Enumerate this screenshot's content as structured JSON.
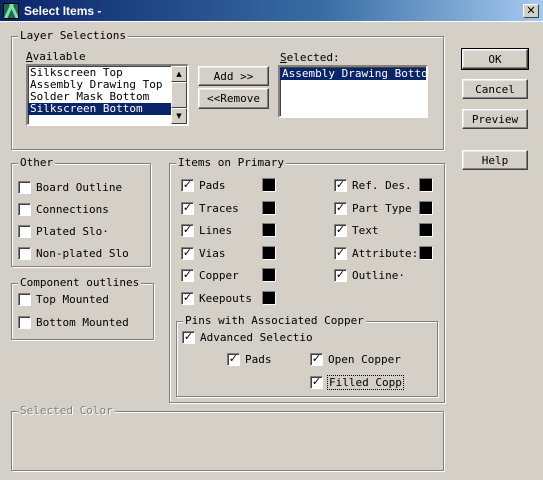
{
  "window": {
    "title": "Select Items -",
    "close_symbol": "✕"
  },
  "layer_selections": {
    "group_label": "Layer Selections",
    "available_label": "Available",
    "available_items": [
      "Silkscreen Top",
      "Assembly Drawing Top",
      "Solder Mask Bottom",
      "Silkscreen Bottom"
    ],
    "available_selected": "Silkscreen Bottom",
    "selected_label": "Selected:",
    "selected_items": [
      "Assembly Drawing Bottom"
    ],
    "add_label": "Add >>",
    "remove_label": "<<Remove",
    "scroll_up": "▲",
    "scroll_down": "▼"
  },
  "buttons": {
    "ok": "OK",
    "cancel": "Cancel",
    "preview": "Preview",
    "help": "Help"
  },
  "other": {
    "group_label": "Other",
    "board_outline": "Board Outline",
    "connections": "Connections",
    "plated_slots": "Plated Slo·",
    "non_plated_slots": "Non-plated Slo"
  },
  "component_outlines": {
    "group_label": "Component outlines",
    "top_mounted": "Top Mounted",
    "bottom_mounted": "Bottom Mounted"
  },
  "items_on_primary": {
    "group_label": "Items on Primary",
    "pads": "Pads",
    "traces": "Traces",
    "lines": "Lines",
    "vias": "Vias",
    "copper": "Copper",
    "keepouts": "Keepouts",
    "ref_des": "Ref. Des.",
    "part_type": "Part Type",
    "text": "Text",
    "attributes": "Attribute:",
    "outlines": "Outline·",
    "swatch_color": "#000000",
    "check_mark": "✓"
  },
  "pins_copper": {
    "group_label": "Pins with Associated Copper",
    "advanced": "Advanced Selectio",
    "pads": "Pads",
    "open_copper": "Open Copper",
    "filled_copper": "Filled Copp"
  },
  "selected_color": {
    "group_label": "Selected Color"
  }
}
